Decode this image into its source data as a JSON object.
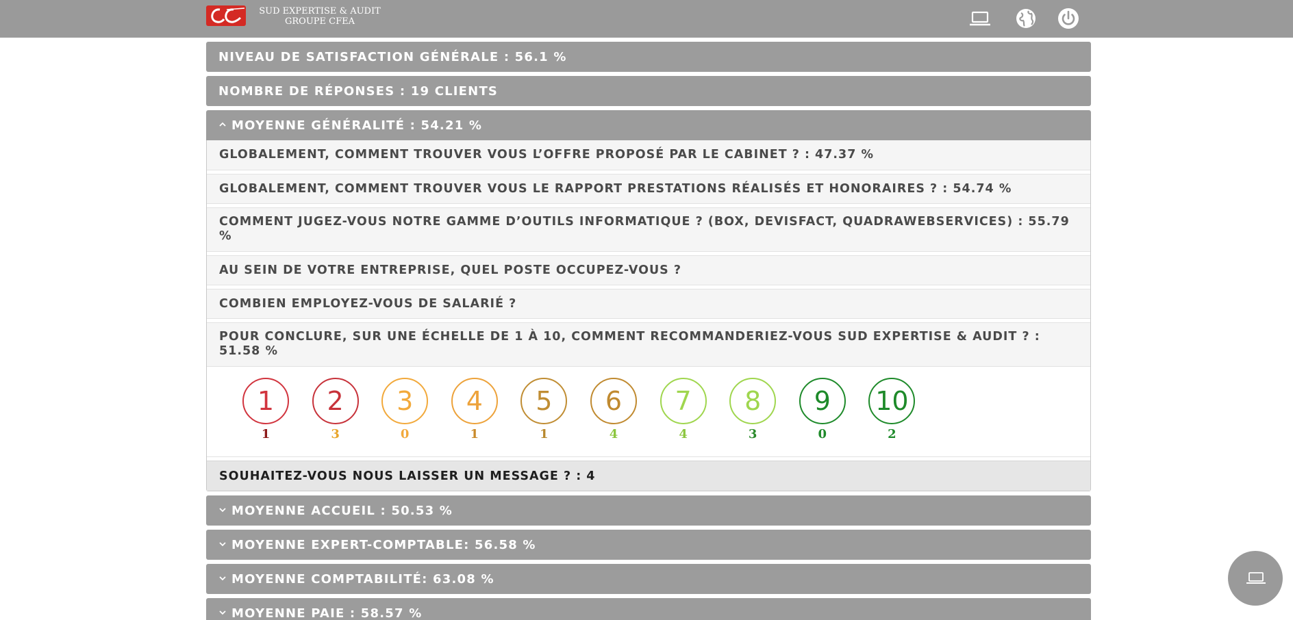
{
  "header": {
    "brand_line1": "SUD EXPERTISE & AUDIT",
    "brand_line2": "GROUPE CFEA",
    "icons": [
      "laptop-icon",
      "globe-icon",
      "power-icon"
    ]
  },
  "sections": {
    "satisfaction": "NIVEAU DE SATISFACTION GÉNÉRALE : 56.1 %",
    "responses": "NOMBRE DE RÉPONSES : 19 CLIENTS",
    "generalite": "MOYENNE GÉNÉRALITÉ : 54.21 %",
    "accueil": "MOYENNE ACCUEIL : 50.53 %",
    "expert": "MOYENNE EXPERT-COMPTABLE: 56.58 %",
    "comptabilite": "MOYENNE COMPTABILITÉ: 63.08 %",
    "paie": "MOYENNE PAIE : 58.57 %"
  },
  "questions": [
    "GLOBALEMENT, COMMENT TROUVER VOUS L’OFFRE PROPOSÉ PAR LE CABINET ? : 47.37 %",
    "GLOBALEMENT, COMMENT TROUVER VOUS LE RAPPORT PRESTATIONS RÉALISÉS ET HONORAIRES ? : 54.74 %",
    "COMMENT JUGEZ-VOUS NOTRE GAMME D’OUTILS INFORMATIQUE ? (BOX, DEVISFACT, QUADRAWEBSERVICES) : 55.79 %",
    "AU SEIN DE VOTRE ENTREPRISE, QUEL POSTE OCCUPEZ-VOUS ?",
    "COMBIEN EMPLOYEZ-VOUS DE SALARIÉ ?",
    "POUR CONCLURE, SUR UNE ÉCHELLE DE 1 À 10, COMMENT RECOMMANDERIEZ-VOUS SUD EXPERTISE & AUDIT ? : 51.58 %"
  ],
  "scale": [
    {
      "label": "1",
      "count": "1",
      "color": "#d1343e",
      "count_color": "#8c1a1a"
    },
    {
      "label": "2",
      "count": "3",
      "color": "#c7323a",
      "count_color": "#e8a52b"
    },
    {
      "label": "3",
      "count": "0",
      "color": "#f2a93b",
      "count_color": "#f2a93b"
    },
    {
      "label": "4",
      "count": "1",
      "color": "#eda23a",
      "count_color": "#c98a2a"
    },
    {
      "label": "5",
      "count": "1",
      "color": "#c08d33",
      "count_color": "#b8892e"
    },
    {
      "label": "6",
      "count": "4",
      "color": "#c08a30",
      "count_color": "#8cc63f"
    },
    {
      "label": "7",
      "count": "4",
      "color": "#9fd64e",
      "count_color": "#8cc63f"
    },
    {
      "label": "8",
      "count": "3",
      "color": "#9fd64e",
      "count_color": "#2b8a2b"
    },
    {
      "label": "9",
      "count": "0",
      "color": "#1e8a2a",
      "count_color": "#1e8a2a"
    },
    {
      "label": "10",
      "count": "2",
      "color": "#1e8a2a",
      "count_color": "#1e8a2a"
    }
  ],
  "message_row": "SOUHAITEZ-VOUS NOUS LAISSER UN MESSAGE ? : 4",
  "chevrons": {
    "open": "^",
    "closed": "v"
  },
  "fab_icon": "laptop-icon"
}
